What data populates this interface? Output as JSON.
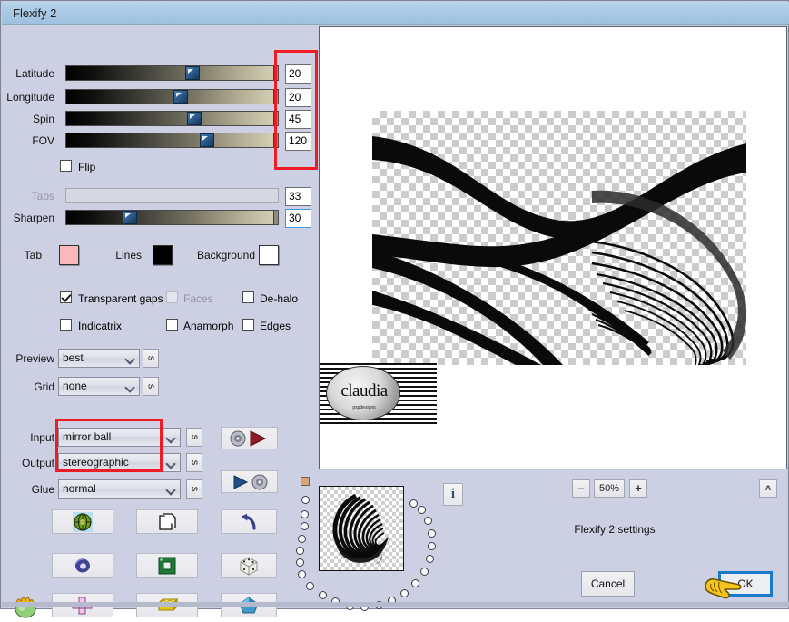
{
  "window": {
    "title": "Flexify 2"
  },
  "sliders": [
    {
      "label": "Latitude",
      "value": "20",
      "pos_pct": 57,
      "disabled": false,
      "focused": false
    },
    {
      "label": "Longitude",
      "value": "20",
      "pos_pct": 52,
      "disabled": false,
      "focused": false
    },
    {
      "label": "Spin",
      "value": "45",
      "pos_pct": 57,
      "disabled": false,
      "focused": false
    },
    {
      "label": "FOV",
      "value": "120",
      "pos_pct": 63,
      "disabled": false,
      "focused": false
    }
  ],
  "flip": {
    "label": "Flip",
    "checked": false
  },
  "sliders2": [
    {
      "label": "Tabs",
      "value": "33",
      "pos_pct": 0,
      "disabled": true,
      "focused": false
    },
    {
      "label": "Sharpen",
      "value": "30",
      "pos_pct": 30,
      "disabled": false,
      "focused": true
    }
  ],
  "colors": {
    "tab_label": "Tab",
    "tab_color": "#f7b9b9",
    "lines_label": "Lines",
    "lines_color": "#000000",
    "background_label": "Background",
    "background_color": "#ffffff"
  },
  "checkboxes": [
    {
      "label": "Transparent gaps",
      "checked": true,
      "disabled": false
    },
    {
      "label": "Faces",
      "checked": false,
      "disabled": true
    },
    {
      "label": "De-halo",
      "checked": false,
      "disabled": false
    },
    {
      "label": "Indicatrix",
      "checked": false,
      "disabled": false
    },
    {
      "label": "Anamorph",
      "checked": false,
      "disabled": false
    },
    {
      "label": "Edges",
      "checked": false,
      "disabled": false
    }
  ],
  "selects": [
    {
      "label": "Preview",
      "value": "best",
      "side_button": "s"
    },
    {
      "label": "Grid",
      "value": "none",
      "side_button": "s"
    },
    {
      "label": "Input",
      "value": "mirror ball",
      "side_button": "s"
    },
    {
      "label": "Output",
      "value": "stereographic",
      "side_button": "s"
    },
    {
      "label": "Glue",
      "value": "normal",
      "side_button": "s"
    }
  ],
  "transfer_buttons": {
    "load_icon": "disc-to-red-arrow-icon",
    "save_icon": "blue-arrow-to-disc-icon"
  },
  "shape_buttons": [
    {
      "name": "globe-icon"
    },
    {
      "name": "pages-icon"
    },
    {
      "name": "undo-arrow-icon"
    },
    {
      "name": "torus-icon"
    },
    {
      "name": "square-frame-icon"
    },
    {
      "name": "dice-icon"
    },
    {
      "name": "cross-net-icon"
    },
    {
      "name": "lego-brick-icon"
    },
    {
      "name": "gem-icon"
    }
  ],
  "toad_icon": "toad-icon",
  "zoom": {
    "minus": "–",
    "value": "50%",
    "plus": "+",
    "collapse": "˄"
  },
  "info_button": "i",
  "status_text": "Flexify 2 settings",
  "dialog_buttons": {
    "cancel": "Cancel",
    "ok": "OK"
  },
  "watermark": {
    "text": "claudia",
    "subtext": "pspdesigns"
  },
  "cursor": "pointing-hand-cursor"
}
